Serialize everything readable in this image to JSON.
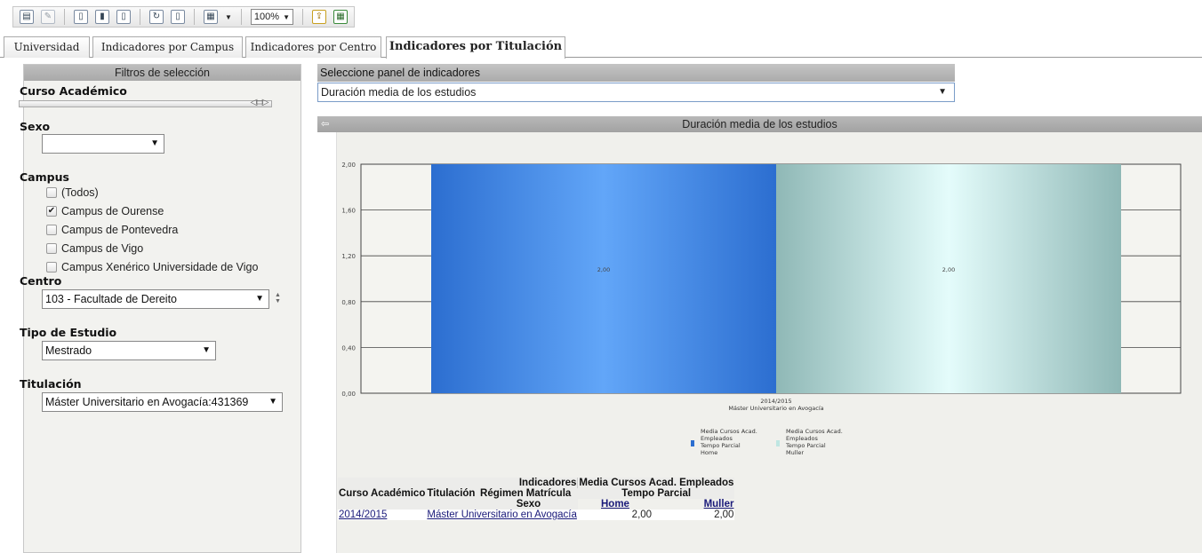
{
  "toolbar": {
    "zoom": "100%"
  },
  "tabs": [
    {
      "label": "Universidad"
    },
    {
      "label": "Indicadores por Campus"
    },
    {
      "label": "Indicadores por Centro"
    },
    {
      "label": "Indicadores por Titulación"
    }
  ],
  "filters": {
    "header": "Filtros de selección",
    "curso_label": "Curso Académico",
    "sexo_label": "Sexo",
    "sexo_value": "",
    "campus_label": "Campus",
    "campus_options": [
      {
        "label": "(Todos)",
        "checked": false
      },
      {
        "label": "Campus de Ourense",
        "checked": true
      },
      {
        "label": "Campus de Pontevedra",
        "checked": false
      },
      {
        "label": "Campus de Vigo",
        "checked": false
      },
      {
        "label": "Campus Xenérico Universidade de Vigo",
        "checked": false
      }
    ],
    "centro_label": "Centro",
    "centro_value": "103 - Facultade de Dereito",
    "tipo_label": "Tipo de Estudio",
    "tipo_value": "Mestrado",
    "titulacion_label": "Titulación",
    "titulacion_value": "Máster Universitario en Avogacía:431369"
  },
  "panel": {
    "header": "Seleccione panel de indicadores",
    "selected": "Duración media de los estudios"
  },
  "chart_data": {
    "type": "bar",
    "title": "Duración media de los estudios",
    "categories": [
      "2014/2015"
    ],
    "category_sublabel": "Máster Universitario en Avogacía",
    "ylim": [
      0,
      2
    ],
    "yticks": [
      "0,00",
      "0,40",
      "0,80",
      "1,20",
      "1,60",
      "2,00"
    ],
    "series": [
      {
        "name": "Media Cursos Acad. Empleados Tempo Parcial Home",
        "values": [
          2.0
        ],
        "label": "2,00",
        "color": "#4a86e0"
      },
      {
        "name": "Media Cursos Acad. Empleados Tempo Parcial Muller",
        "values": [
          2.0
        ],
        "label": "2,00",
        "color": "#bfe6e2"
      }
    ],
    "legend": [
      [
        "Media Cursos Acad.",
        "Empleados",
        "Tempo Parcial",
        "Home"
      ],
      [
        "Media Cursos Acad.",
        "Empleados",
        "Tempo Parcial",
        "Muller"
      ]
    ],
    "grid": true,
    "legend_position": "bottom"
  },
  "table": {
    "indicadores_label": "Indicadores",
    "measure_label": "Media Cursos Acad. Empleados",
    "curso_header": "Curso Académico",
    "titulacion_header": "Titulación",
    "regimen_header": "Régimen Matrícula",
    "regimen_value": "Tempo Parcial",
    "sexo_header": "Sexo",
    "sexo_home": "Home",
    "sexo_muller": "Muller",
    "rows": [
      {
        "curso": "2014/2015",
        "titulacion": "Máster Universitario en Avogacía",
        "home": "2,00",
        "muller": "2,00"
      }
    ]
  }
}
